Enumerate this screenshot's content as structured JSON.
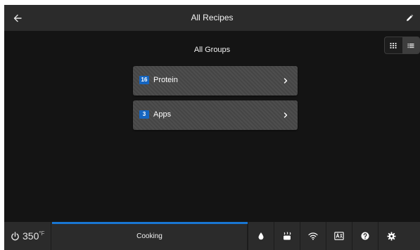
{
  "header": {
    "title": "All Recipes",
    "back_icon": "arrow-left-icon",
    "edit_icon": "pencil-icon"
  },
  "view_toggle": {
    "options": [
      "grid",
      "list"
    ],
    "selected": "list"
  },
  "groups": {
    "heading": "All Groups",
    "items": [
      {
        "count": "16",
        "name": "Protein"
      },
      {
        "count": "3",
        "name": "Apps"
      }
    ]
  },
  "bottom_bar": {
    "temperature": "350",
    "temperature_unit": "°F",
    "status": "Cooking",
    "progress": 1.0,
    "icons": [
      "water-drop-icon",
      "steam-icon",
      "wifi-icon",
      "translate-icon",
      "help-icon",
      "settings-icon"
    ]
  },
  "colors": {
    "accent": "#1976d2",
    "badge": "#1565c0",
    "header_bg": "#2b2b2b",
    "screen_bg": "#141414"
  }
}
